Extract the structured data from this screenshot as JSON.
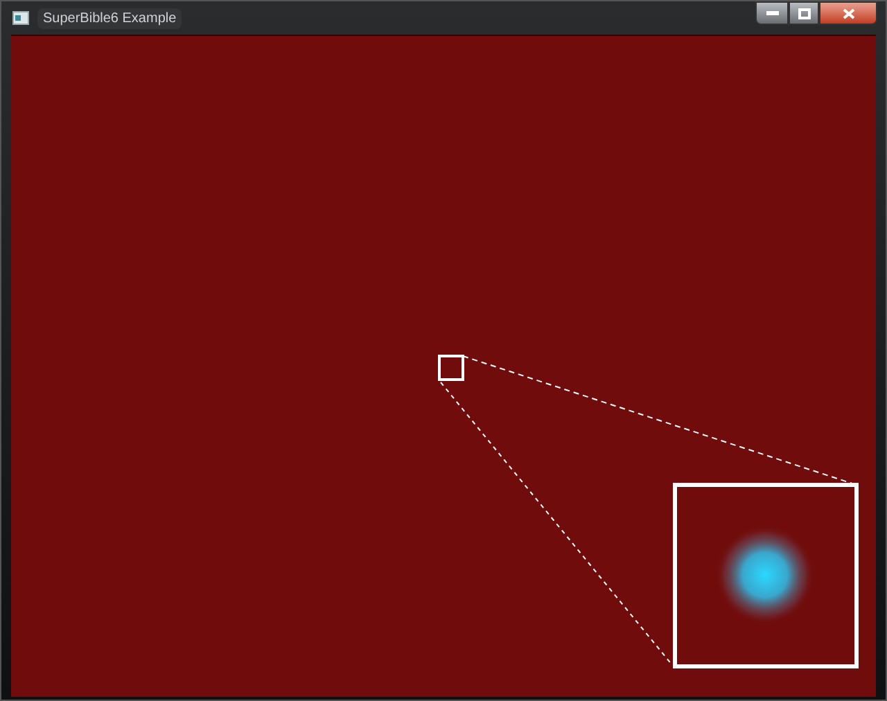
{
  "window": {
    "title": "SuperBible6 Example"
  }
}
